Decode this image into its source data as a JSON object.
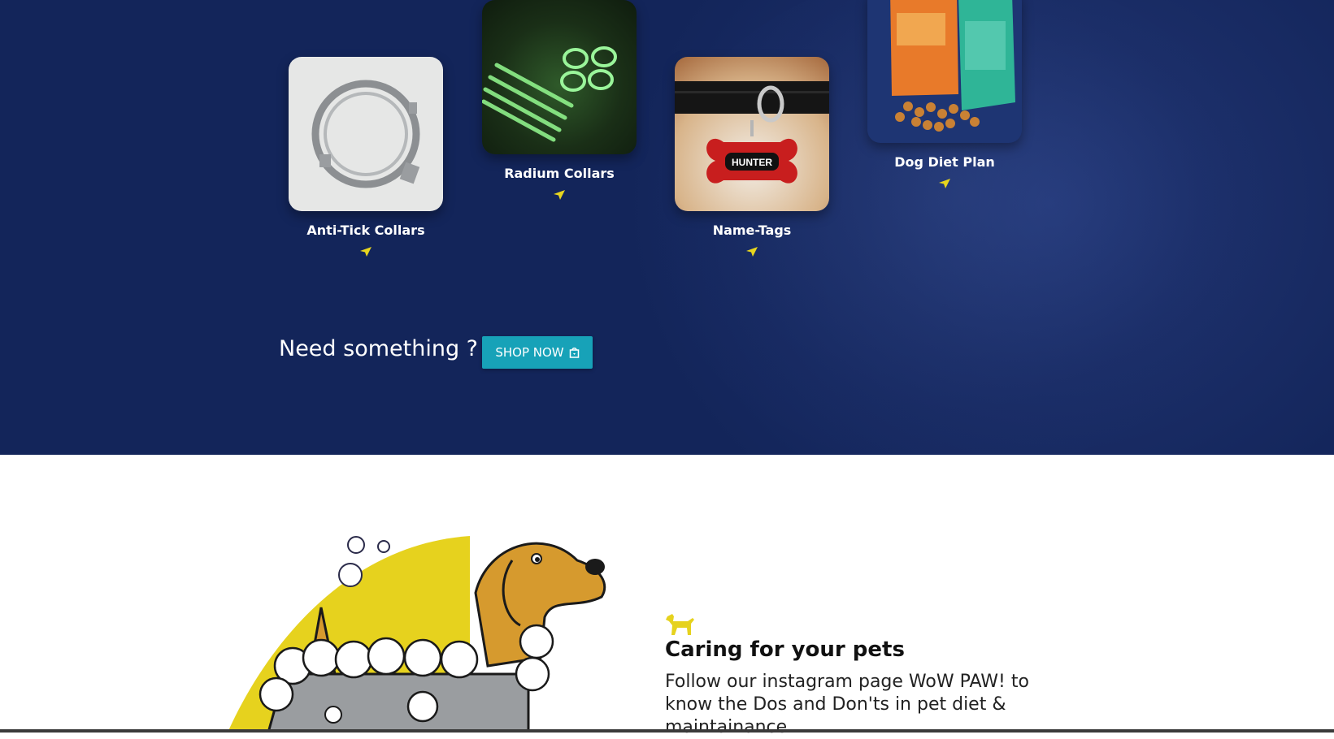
{
  "products": [
    {
      "name": "Anti-Tick Collars",
      "image": "anti-tick-collar-image"
    },
    {
      "name": "Radium Collars",
      "image": "glow-collars-image"
    },
    {
      "name": "Name-Tags",
      "image": "name-tag-image",
      "tag_text": "HUNTER"
    },
    {
      "name": "Dog Diet Plan",
      "image": "dog-food-bags-image"
    }
  ],
  "cta": {
    "text": "Need something ?",
    "button_label": "SHOP NOW",
    "button_icon": "shopping-bag-icon"
  },
  "care": {
    "icon": "dog-silhouette-icon",
    "title": "Caring for your pets",
    "text": "Follow our instagram page WoW PAW! to know the Dos and Don'ts in pet diet & maintainance"
  },
  "colors": {
    "hero_bg": "#1b2e68",
    "accent_yellow": "#e8d61e",
    "button_teal": "#17a2b8",
    "text_white": "#ffffff"
  }
}
